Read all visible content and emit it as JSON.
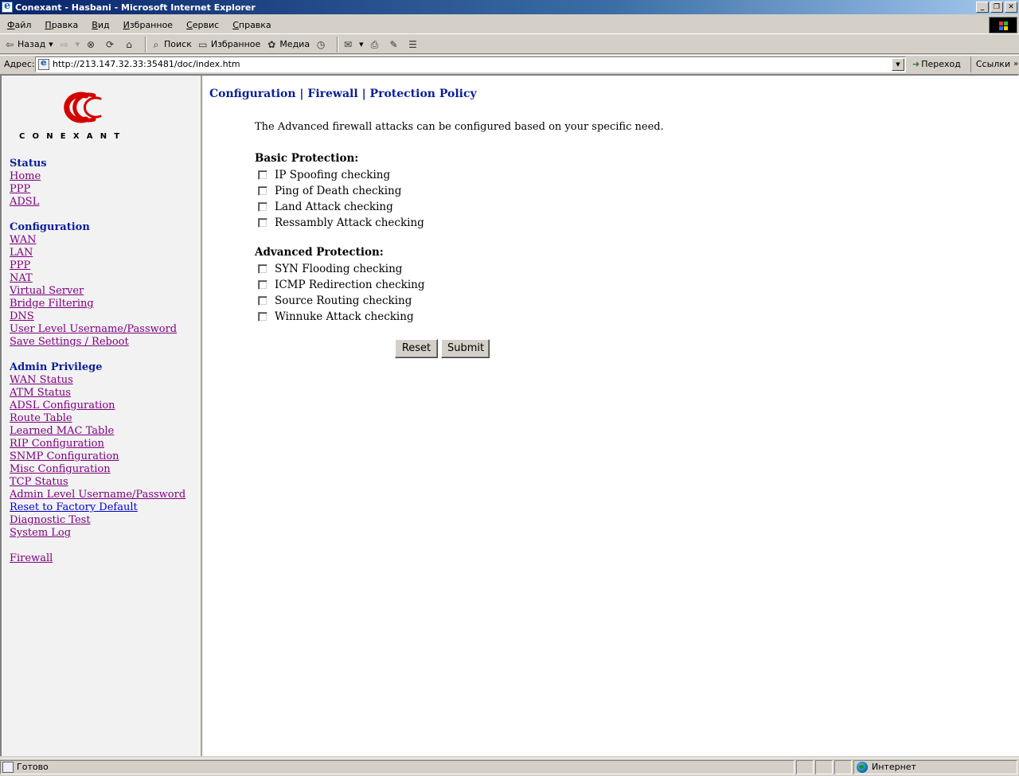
{
  "window": {
    "title": "Conexant - Hasbani - Microsoft Internet Explorer",
    "minimize": "_",
    "restore": "❐",
    "close": "✕"
  },
  "menu": [
    "Файл",
    "Правка",
    "Вид",
    "Избранное",
    "Сервис",
    "Справка"
  ],
  "toolbar": {
    "back": "Назад",
    "search": "Поиск",
    "favorites": "Избранное",
    "media": "Медиа"
  },
  "address": {
    "label": "Адрес:",
    "url": "http://213.147.32.33:35481/doc/index.htm",
    "go": "Переход",
    "links": "Ссылки",
    "more": "»"
  },
  "sidebar": {
    "logo_text": "CONEXANT",
    "status": {
      "title": "Status",
      "items": [
        "Home",
        "PPP",
        "ADSL"
      ]
    },
    "configuration": {
      "title": "Configuration",
      "items": [
        "WAN",
        "LAN",
        "PPP",
        "NAT",
        "Virtual Server",
        "Bridge Filtering",
        "DNS",
        "User Level Username/Password",
        "Save Settings / Reboot"
      ]
    },
    "admin": {
      "title": "Admin Privilege",
      "items": [
        "WAN Status",
        "ATM Status",
        "ADSL Configuration",
        "Route Table",
        "Learned MAC Table",
        "RIP Configuration",
        "SNMP Configuration",
        "Misc Configuration",
        "TCP Status",
        "Admin Level Username/Password",
        "Reset to Factory Default",
        "Diagnostic Test",
        "System Log"
      ]
    },
    "firewall": "Firewall"
  },
  "main": {
    "breadcrumb": "Configuration | Firewall | Protection Policy",
    "intro": "The Advanced firewall attacks can be configured based on your specific need.",
    "basic": {
      "title": "Basic Protection:",
      "items": [
        "IP Spoofing checking",
        "Ping of Death checking",
        "Land Attack checking",
        "Ressambly Attack checking"
      ]
    },
    "advanced": {
      "title": "Advanced Protection:",
      "items": [
        "SYN Flooding checking",
        "ICMP Redirection checking",
        "Source Routing checking",
        "Winnuke Attack checking"
      ]
    },
    "reset_label": "Reset",
    "submit_label": "Submit"
  },
  "status_bar": {
    "status": "Готово",
    "zone": "Интернет"
  }
}
